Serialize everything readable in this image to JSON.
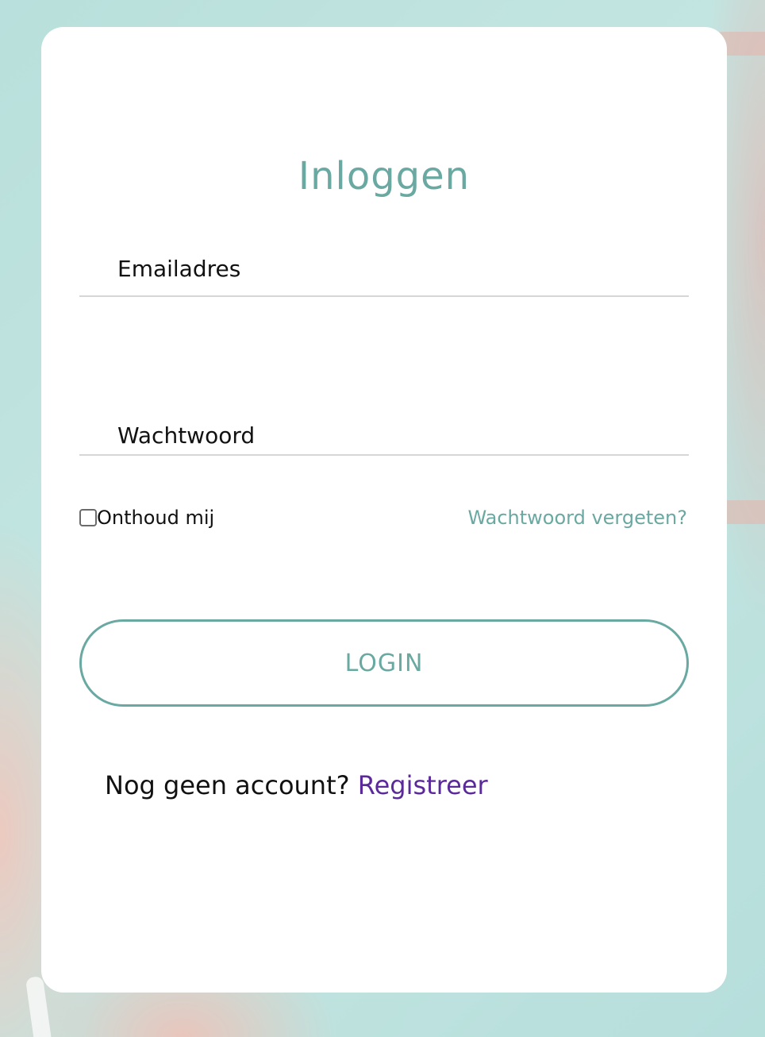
{
  "login_card": {
    "title": "Inloggen",
    "email_field": {
      "placeholder": "Emailadres",
      "value": ""
    },
    "password_field": {
      "placeholder": "Wachtwoord",
      "value": ""
    },
    "remember_me": {
      "label": "Onthoud mij",
      "checked": false
    },
    "forgot_password_link": "Wachtwoord vergeten?",
    "login_button": "LOGIN",
    "register_prompt": "Nog geen account?",
    "register_link": "Registreer"
  },
  "colors": {
    "accent": "#6aa9a2",
    "link_purple": "#5b2a9a",
    "text": "#111111",
    "card": "#ffffff",
    "background": "#bfe3df"
  }
}
